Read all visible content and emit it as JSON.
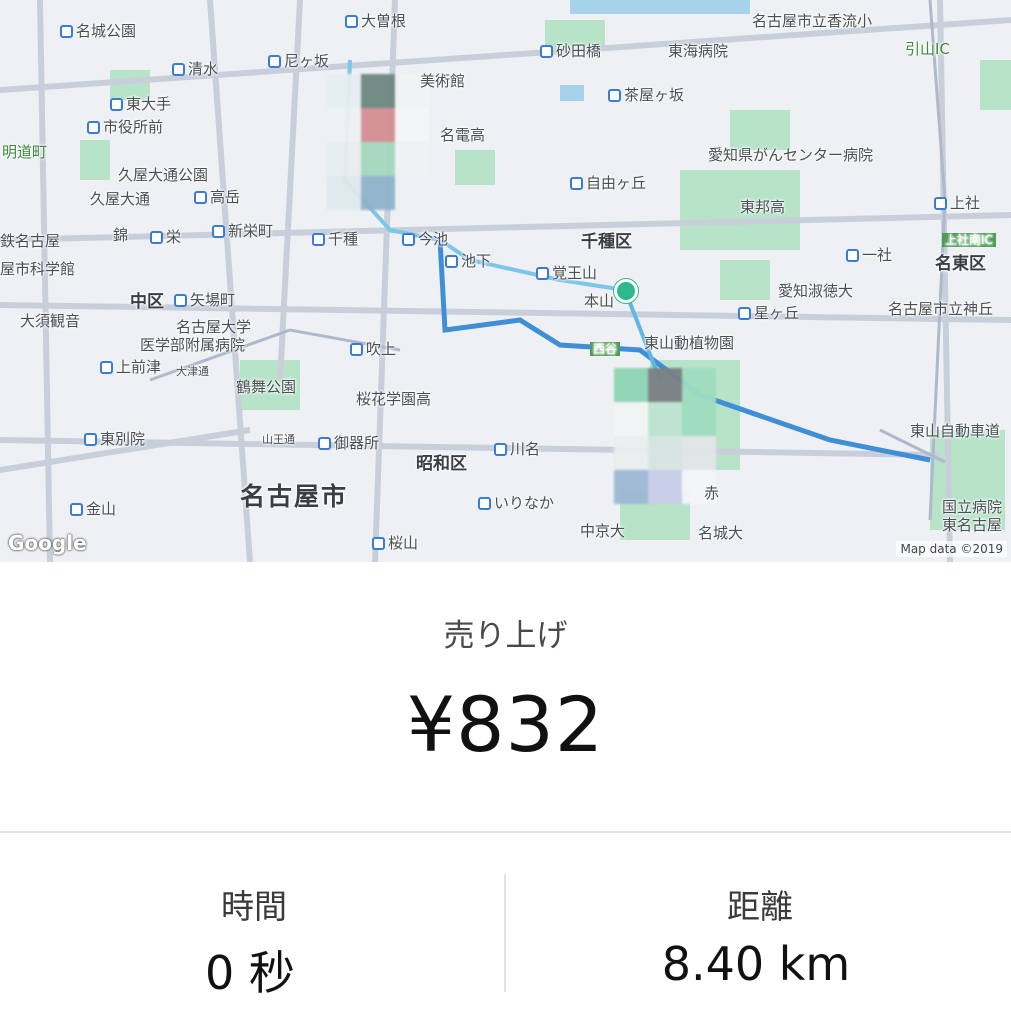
{
  "map": {
    "attribution_logo": "Google",
    "attribution_text": "Map data ©2019",
    "city": "名古屋市",
    "districts": [
      "中区",
      "千種区",
      "昭和区",
      "名東区"
    ],
    "labels": [
      "名城公園",
      "大曽根",
      "砂田橋",
      "東海病院",
      "名古屋市立香流小",
      "引山IC",
      "清水",
      "尼ヶ坂",
      "美術館",
      "茶屋ヶ坂",
      "東大手",
      "市役所前",
      "名電高",
      "愛知県がんセンター病院",
      "明道町",
      "久屋大通公園",
      "自由ヶ丘",
      "久屋大通",
      "高岳",
      "東邦高",
      "上社",
      "鉄名古屋",
      "錦",
      "栄",
      "新栄町",
      "千種",
      "今池",
      "一社",
      "上社南IC",
      "屋市科学館",
      "池下",
      "覚王山",
      "愛知淑徳大",
      "矢場町",
      "本山",
      "星ヶ丘",
      "名古屋市立神丘",
      "大須観音",
      "名古屋大学",
      "医学部附属病院",
      "吹上",
      "西谷",
      "東山動植物園",
      "上前津",
      "鶴舞公園",
      "桜花学園高",
      "名古屋市",
      "東別院",
      "御器所",
      "川名",
      "東山自動車道",
      "金山",
      "いりなか",
      "赤",
      "国立病院",
      "東名古屋",
      "桜山",
      "中京大",
      "名城大",
      "山王通",
      "大津通"
    ]
  },
  "summary": {
    "sales_label": "売り上げ",
    "amount": "¥832",
    "time_label": "時間",
    "time_value": "0 秒",
    "distance_label": "距離",
    "distance_value": "8.40 km"
  },
  "colors": {
    "route": "#3f8fd6",
    "route_secondary": "#7cc6e8",
    "pin": "#2db88e",
    "park": "#a9dcbf",
    "road": "#c2cad6"
  }
}
